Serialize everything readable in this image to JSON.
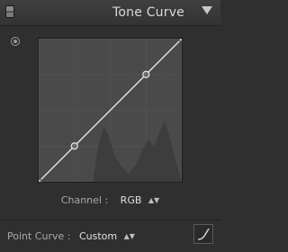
{
  "panel": {
    "title": "Tone Curve",
    "toggle_icon": "panel-toggle-icon",
    "collapse_icon": "triangle-down-icon",
    "target_icon": "targeted-adjustment-icon"
  },
  "curve": {
    "channel_label": "Channel :",
    "channel_value": "RGB",
    "point_curve_label": "Point Curve :",
    "point_curve_value": "Custom",
    "points": [
      [
        0,
        0
      ],
      [
        0.25,
        0.25
      ],
      [
        0.75,
        0.75
      ],
      [
        1,
        1
      ]
    ],
    "edit_icon": "edit-point-curve-icon"
  },
  "colors": {
    "panel_bg": "#2f2f2f",
    "graph_bg": "#4a4a4a",
    "curve": "#e6e6e6"
  }
}
